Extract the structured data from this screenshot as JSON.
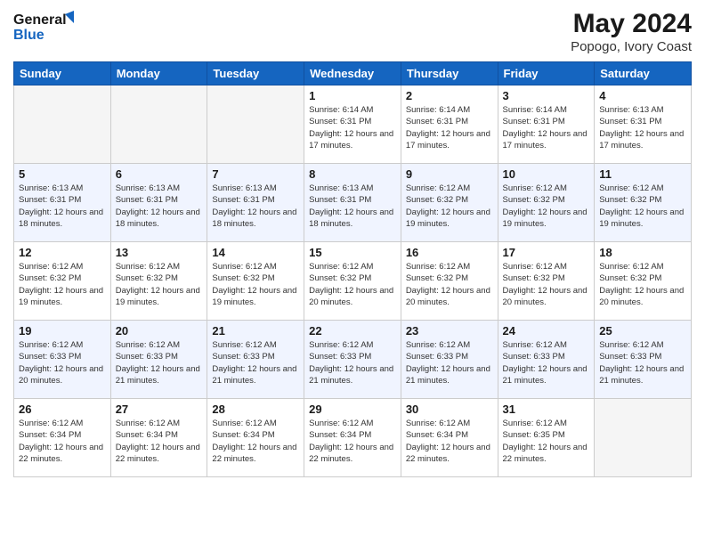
{
  "header": {
    "logo_line1": "General",
    "logo_line2": "Blue",
    "month_year": "May 2024",
    "location": "Popogo, Ivory Coast"
  },
  "weekdays": [
    "Sunday",
    "Monday",
    "Tuesday",
    "Wednesday",
    "Thursday",
    "Friday",
    "Saturday"
  ],
  "rows": [
    {
      "alt": false,
      "cells": [
        {
          "day": "",
          "info": ""
        },
        {
          "day": "",
          "info": ""
        },
        {
          "day": "",
          "info": ""
        },
        {
          "day": "1",
          "info": "Sunrise: 6:14 AM\nSunset: 6:31 PM\nDaylight: 12 hours\nand 17 minutes."
        },
        {
          "day": "2",
          "info": "Sunrise: 6:14 AM\nSunset: 6:31 PM\nDaylight: 12 hours\nand 17 minutes."
        },
        {
          "day": "3",
          "info": "Sunrise: 6:14 AM\nSunset: 6:31 PM\nDaylight: 12 hours\nand 17 minutes."
        },
        {
          "day": "4",
          "info": "Sunrise: 6:13 AM\nSunset: 6:31 PM\nDaylight: 12 hours\nand 17 minutes."
        }
      ]
    },
    {
      "alt": true,
      "cells": [
        {
          "day": "5",
          "info": "Sunrise: 6:13 AM\nSunset: 6:31 PM\nDaylight: 12 hours\nand 18 minutes."
        },
        {
          "day": "6",
          "info": "Sunrise: 6:13 AM\nSunset: 6:31 PM\nDaylight: 12 hours\nand 18 minutes."
        },
        {
          "day": "7",
          "info": "Sunrise: 6:13 AM\nSunset: 6:31 PM\nDaylight: 12 hours\nand 18 minutes."
        },
        {
          "day": "8",
          "info": "Sunrise: 6:13 AM\nSunset: 6:31 PM\nDaylight: 12 hours\nand 18 minutes."
        },
        {
          "day": "9",
          "info": "Sunrise: 6:12 AM\nSunset: 6:32 PM\nDaylight: 12 hours\nand 19 minutes."
        },
        {
          "day": "10",
          "info": "Sunrise: 6:12 AM\nSunset: 6:32 PM\nDaylight: 12 hours\nand 19 minutes."
        },
        {
          "day": "11",
          "info": "Sunrise: 6:12 AM\nSunset: 6:32 PM\nDaylight: 12 hours\nand 19 minutes."
        }
      ]
    },
    {
      "alt": false,
      "cells": [
        {
          "day": "12",
          "info": "Sunrise: 6:12 AM\nSunset: 6:32 PM\nDaylight: 12 hours\nand 19 minutes."
        },
        {
          "day": "13",
          "info": "Sunrise: 6:12 AM\nSunset: 6:32 PM\nDaylight: 12 hours\nand 19 minutes."
        },
        {
          "day": "14",
          "info": "Sunrise: 6:12 AM\nSunset: 6:32 PM\nDaylight: 12 hours\nand 19 minutes."
        },
        {
          "day": "15",
          "info": "Sunrise: 6:12 AM\nSunset: 6:32 PM\nDaylight: 12 hours\nand 20 minutes."
        },
        {
          "day": "16",
          "info": "Sunrise: 6:12 AM\nSunset: 6:32 PM\nDaylight: 12 hours\nand 20 minutes."
        },
        {
          "day": "17",
          "info": "Sunrise: 6:12 AM\nSunset: 6:32 PM\nDaylight: 12 hours\nand 20 minutes."
        },
        {
          "day": "18",
          "info": "Sunrise: 6:12 AM\nSunset: 6:32 PM\nDaylight: 12 hours\nand 20 minutes."
        }
      ]
    },
    {
      "alt": true,
      "cells": [
        {
          "day": "19",
          "info": "Sunrise: 6:12 AM\nSunset: 6:33 PM\nDaylight: 12 hours\nand 20 minutes."
        },
        {
          "day": "20",
          "info": "Sunrise: 6:12 AM\nSunset: 6:33 PM\nDaylight: 12 hours\nand 21 minutes."
        },
        {
          "day": "21",
          "info": "Sunrise: 6:12 AM\nSunset: 6:33 PM\nDaylight: 12 hours\nand 21 minutes."
        },
        {
          "day": "22",
          "info": "Sunrise: 6:12 AM\nSunset: 6:33 PM\nDaylight: 12 hours\nand 21 minutes."
        },
        {
          "day": "23",
          "info": "Sunrise: 6:12 AM\nSunset: 6:33 PM\nDaylight: 12 hours\nand 21 minutes."
        },
        {
          "day": "24",
          "info": "Sunrise: 6:12 AM\nSunset: 6:33 PM\nDaylight: 12 hours\nand 21 minutes."
        },
        {
          "day": "25",
          "info": "Sunrise: 6:12 AM\nSunset: 6:33 PM\nDaylight: 12 hours\nand 21 minutes."
        }
      ]
    },
    {
      "alt": false,
      "cells": [
        {
          "day": "26",
          "info": "Sunrise: 6:12 AM\nSunset: 6:34 PM\nDaylight: 12 hours\nand 22 minutes."
        },
        {
          "day": "27",
          "info": "Sunrise: 6:12 AM\nSunset: 6:34 PM\nDaylight: 12 hours\nand 22 minutes."
        },
        {
          "day": "28",
          "info": "Sunrise: 6:12 AM\nSunset: 6:34 PM\nDaylight: 12 hours\nand 22 minutes."
        },
        {
          "day": "29",
          "info": "Sunrise: 6:12 AM\nSunset: 6:34 PM\nDaylight: 12 hours\nand 22 minutes."
        },
        {
          "day": "30",
          "info": "Sunrise: 6:12 AM\nSunset: 6:34 PM\nDaylight: 12 hours\nand 22 minutes."
        },
        {
          "day": "31",
          "info": "Sunrise: 6:12 AM\nSunset: 6:35 PM\nDaylight: 12 hours\nand 22 minutes."
        },
        {
          "day": "",
          "info": ""
        }
      ]
    }
  ]
}
